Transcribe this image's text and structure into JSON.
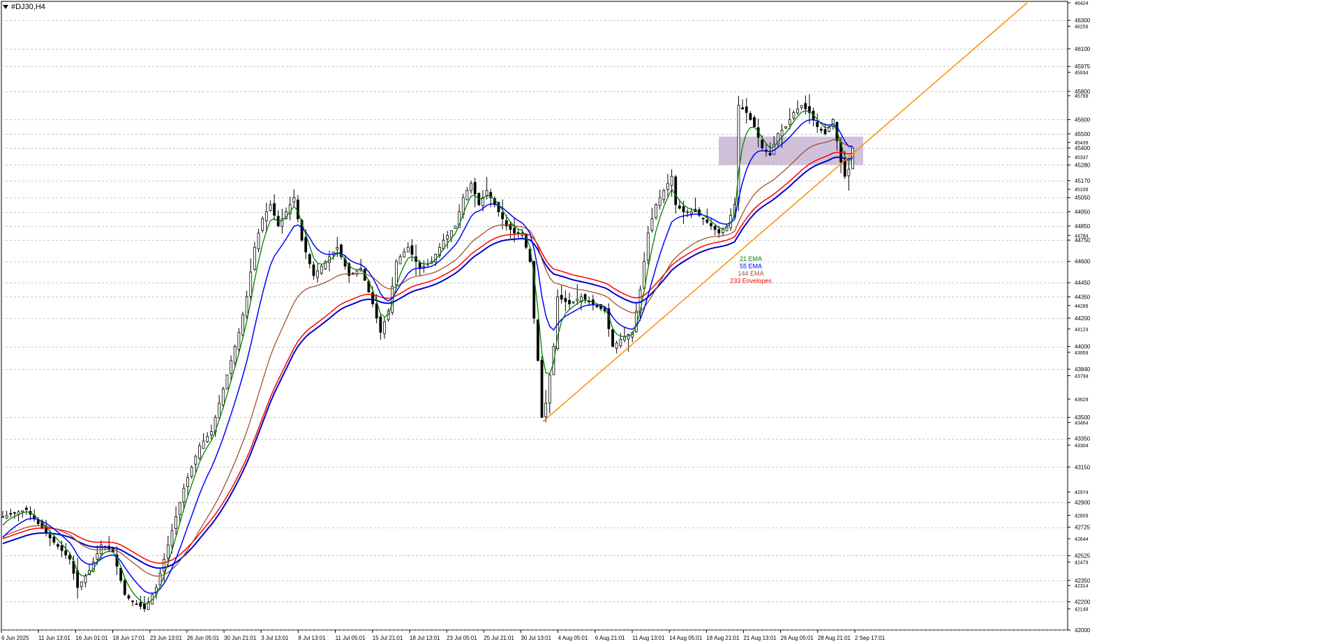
{
  "window": {
    "symbol_title": "#DJ30,H4"
  },
  "colors": {
    "background": "#ffffff",
    "grid": "#c8c8c8",
    "axis_text": "#000000",
    "label_box": "#ffffff",
    "candle": "#000000",
    "ema21": "#008000",
    "ema55": "#0000ff",
    "ema144": "#a0522d",
    "env233_upper": "#ff0000",
    "env233_lower": "#0000cc",
    "trendline": "#ff8c00",
    "zone": "#c9b5d3"
  },
  "chart_data": {
    "type": "line",
    "title": "#DJ30,H4",
    "ylim": [
      42000,
      46424
    ],
    "price_levels": [
      "46424",
      "46300",
      "46259",
      "46100",
      "45975",
      "45934",
      "45800",
      "45769",
      "45600",
      "45500",
      "45439",
      "45400",
      "45337",
      "45280",
      "45170",
      "45109",
      "45050",
      "44950",
      "44850",
      "44784",
      "44750",
      "44600",
      "44450",
      "44350",
      "44289",
      "44200",
      "44124",
      "44000",
      "43959",
      "43840",
      "43794",
      "43629",
      "43500",
      "43464",
      "43350",
      "43304",
      "43150",
      "42974",
      "42900",
      "42809",
      "42725",
      "42644",
      "42525",
      "42479",
      "42350",
      "42314",
      "42200",
      "42149",
      "42000"
    ],
    "highlighted_levels": [
      "46300",
      "46100",
      "45975",
      "45800",
      "45600",
      "45500",
      "45400",
      "45280",
      "45170",
      "45050",
      "44950",
      "44850",
      "44750",
      "44600",
      "44450",
      "44350",
      "44200",
      "44000",
      "43840",
      "43500",
      "43350",
      "43150",
      "42900",
      "42725",
      "42525",
      "42350",
      "42200",
      "42000"
    ],
    "x_labels": [
      "6 Jun 2025",
      "11 Jun 13:01",
      "16 Jun 01:01",
      "18 Jun 17:01",
      "23 Jun 13:01",
      "26 Jun 05:01",
      "30 Jun 21:01",
      "3 Jul 13:01",
      "8 Jul 13:01",
      "11 Jul 05:01",
      "15 Jul 21:01",
      "18 Jul 13:01",
      "23 Jul 05:01",
      "25 Jul 21:01",
      "30 Jul 13:01",
      "4 Aug 05:01",
      "6 Aug 21:01",
      "11 Aug 13:01",
      "14 Aug 05:01",
      "18 Aug 21:01",
      "21 Aug 13:01",
      "26 Aug 05:01",
      "28 Aug 21:01",
      "2 Sep 17:01"
    ],
    "legend": [
      {
        "name": "21 EMA",
        "color": "#008000"
      },
      {
        "name": "55 EMA",
        "color": "#0000ff"
      },
      {
        "name": "144 EMA",
        "color": "#a0522d"
      },
      {
        "name": "233 Envelopes",
        "color": "#ff0000"
      }
    ],
    "close_path": [
      [
        0,
        42800
      ],
      [
        6,
        42850
      ],
      [
        12,
        42650
      ],
      [
        17,
        42500
      ],
      [
        19,
        42300
      ],
      [
        22,
        42420
      ],
      [
        25,
        42600
      ],
      [
        28,
        42550
      ],
      [
        31,
        42250
      ],
      [
        33,
        42200
      ],
      [
        36,
        42150
      ],
      [
        39,
        42300
      ],
      [
        42,
        42600
      ],
      [
        46,
        43000
      ],
      [
        50,
        43300
      ],
      [
        53,
        43400
      ],
      [
        56,
        43700
      ],
      [
        60,
        44100
      ],
      [
        62,
        44350
      ],
      [
        64,
        44700
      ],
      [
        66,
        44900
      ],
      [
        68,
        45000
      ],
      [
        70,
        44850
      ],
      [
        72,
        44950
      ],
      [
        74,
        45050
      ],
      [
        76,
        44750
      ],
      [
        79,
        44500
      ],
      [
        82,
        44600
      ],
      [
        85,
        44700
      ],
      [
        88,
        44500
      ],
      [
        91,
        44550
      ],
      [
        94,
        44300
      ],
      [
        96,
        44100
      ],
      [
        98,
        44250
      ],
      [
        100,
        44600
      ],
      [
        103,
        44700
      ],
      [
        106,
        44550
      ],
      [
        109,
        44600
      ],
      [
        112,
        44750
      ],
      [
        115,
        44850
      ],
      [
        117,
        45050
      ],
      [
        119,
        45150
      ],
      [
        121,
        45000
      ],
      [
        123,
        45100
      ],
      [
        125,
        45000
      ],
      [
        128,
        44850
      ],
      [
        130,
        44800
      ],
      [
        132,
        44800
      ],
      [
        134,
        44600
      ],
      [
        135,
        44200
      ],
      [
        136,
        43900
      ],
      [
        137,
        43500
      ],
      [
        138,
        43600
      ],
      [
        140,
        44000
      ],
      [
        141,
        44350
      ],
      [
        144,
        44300
      ],
      [
        147,
        44350
      ],
      [
        150,
        44300
      ],
      [
        153,
        44250
      ],
      [
        155,
        44000
      ],
      [
        157,
        44050
      ],
      [
        160,
        44100
      ],
      [
        162,
        44400
      ],
      [
        164,
        44800
      ],
      [
        166,
        45000
      ],
      [
        168,
        45100
      ],
      [
        170,
        45200
      ],
      [
        171,
        45000
      ],
      [
        173,
        44950
      ],
      [
        176,
        44950
      ],
      [
        178,
        44900
      ],
      [
        180,
        44850
      ],
      [
        182,
        44800
      ],
      [
        184,
        44850
      ],
      [
        186,
        45000
      ],
      [
        187,
        45700
      ],
      [
        189,
        45650
      ],
      [
        191,
        45550
      ],
      [
        193,
        45400
      ],
      [
        195,
        45350
      ],
      [
        197,
        45500
      ],
      [
        199,
        45550
      ],
      [
        201,
        45650
      ],
      [
        203,
        45700
      ],
      [
        205,
        45650
      ],
      [
        207,
        45550
      ],
      [
        209,
        45500
      ],
      [
        211,
        45600
      ],
      [
        212,
        45450
      ],
      [
        213,
        45300
      ],
      [
        214,
        45200
      ],
      [
        215,
        45250
      ],
      [
        216,
        45400
      ]
    ],
    "trendline": {
      "from": [
        136,
        43470
      ],
      "to": [
        258,
        46424
      ]
    },
    "zone": {
      "from_x": 181,
      "to_x": 216,
      "y_high": 45480,
      "y_low": 45280
    }
  }
}
